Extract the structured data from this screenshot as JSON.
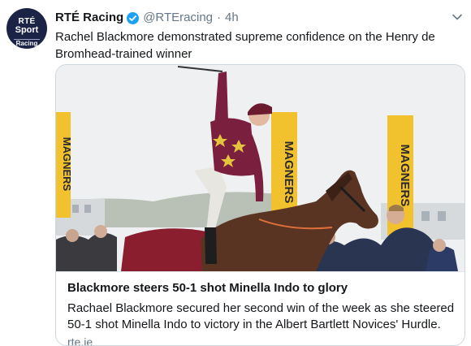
{
  "account": {
    "avatar_line1": "RTÉ",
    "avatar_line2": "Sport",
    "avatar_line3": "Racing",
    "display_name": "RTÉ Racing",
    "handle": "@RTEracing",
    "separator": "·",
    "time": "4h"
  },
  "tweet": {
    "text": "Rachel Blackmore demonstrated supreme confidence on the Henry de Bromhead-trained winner"
  },
  "card": {
    "banner_text": "MAGNERS",
    "title": "Blackmore steers 50-1 shot Minella Indo to glory",
    "description": "Rachael Blackmore secured her second win of the week as she steered 50-1 shot Minella Indo to victory in the Albert Bartlett Novices' Hurdle.",
    "domain": "rte.ie"
  },
  "colors": {
    "verified": "#1da1f2",
    "avatar_bg": "#1b2447",
    "silks": "#7a1f3d",
    "banner": "#f2c12e"
  },
  "icons": [
    "verified-badge-icon",
    "chevron-down-icon"
  ]
}
